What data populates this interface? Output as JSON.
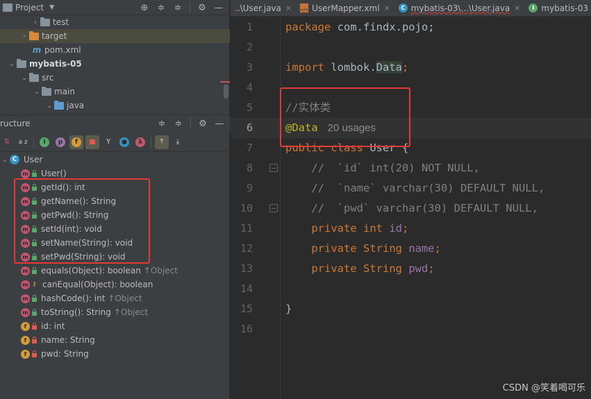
{
  "project_panel": {
    "title": "Project",
    "tree": [
      {
        "label": "test",
        "level": 3,
        "kind": "folder"
      },
      {
        "label": "target",
        "level": 2,
        "kind": "folder-orange"
      },
      {
        "label": "pom.xml",
        "level": 2,
        "kind": "maven"
      },
      {
        "label": "mybatis-05",
        "level": 1,
        "kind": "module"
      },
      {
        "label": "src",
        "level": 2,
        "kind": "folder"
      },
      {
        "label": "main",
        "level": 3,
        "kind": "folder"
      },
      {
        "label": "java",
        "level": 4,
        "kind": "folder-blue"
      }
    ]
  },
  "structure_panel": {
    "title": "ructure",
    "sort_label": "a z",
    "root": "User",
    "members": [
      {
        "name": "User()",
        "kind": "method",
        "vis": "pub"
      },
      {
        "name": "getId(): int",
        "kind": "method",
        "vis": "pub"
      },
      {
        "name": "getName(): String",
        "kind": "method",
        "vis": "pub"
      },
      {
        "name": "getPwd(): String",
        "kind": "method",
        "vis": "pub"
      },
      {
        "name": "setId(int): void",
        "kind": "method",
        "vis": "pub"
      },
      {
        "name": "setName(String): void",
        "kind": "method",
        "vis": "pub"
      },
      {
        "name": "setPwd(String): void",
        "kind": "method",
        "vis": "pub"
      },
      {
        "name": "equals(Object): boolean",
        "inherit": "↑Object",
        "kind": "method",
        "vis": "pub"
      },
      {
        "name": "canEqual(Object): boolean",
        "kind": "method",
        "vis": "prot"
      },
      {
        "name": "hashCode(): int",
        "inherit": "↑Object",
        "kind": "method",
        "vis": "pub"
      },
      {
        "name": "toString(): String",
        "inherit": "↑Object",
        "kind": "method",
        "vis": "pub"
      },
      {
        "name": "id: int",
        "kind": "field",
        "vis": "priv"
      },
      {
        "name": "name: String",
        "kind": "field",
        "vis": "priv"
      },
      {
        "name": "pwd: String",
        "kind": "field",
        "vis": "priv"
      }
    ]
  },
  "tabs": [
    {
      "label": "..\\User.java",
      "icon": "none"
    },
    {
      "label": "UserMapper.xml",
      "icon": "xml-icon"
    },
    {
      "label": "mybatis-03\\...\\User.java",
      "icon": "class-icon",
      "underline": true
    },
    {
      "label": "mybatis-03",
      "icon": "interface-icon"
    }
  ],
  "editor": {
    "line_numbers": [
      "1",
      "2",
      "3",
      "4",
      "5",
      "6",
      "7",
      "8",
      "9",
      "10",
      "11",
      "12",
      "13",
      "14",
      "15",
      "16"
    ],
    "current_line": "6",
    "line1": {
      "kw": "package",
      "rest": " com.findx.pojo;"
    },
    "line3": {
      "kw": "import",
      "pkg": " lombok.",
      "cls": "Data",
      "end": ";"
    },
    "line5": "//实体类",
    "line6": {
      "ann": "@Data",
      "hint": "20 usages"
    },
    "line7": {
      "kw1": "public",
      "kw2": " class",
      "rest": " User {"
    },
    "line8": "    //  `id` int(20) NOT NULL,",
    "line9": "    //  `name` varchar(30) DEFAULT NULL,",
    "line10": "    //  `pwd` varchar(30) DEFAULT NULL,",
    "line11": {
      "kw": "    private",
      "type": " int",
      "field": " id",
      "end": ";"
    },
    "line12": {
      "kw": "    private",
      "type": " String",
      "field": " name",
      "end": ";"
    },
    "line13": {
      "kw": "    private",
      "type": " String",
      "field": " pwd",
      "end": ";"
    },
    "line15": "}"
  },
  "watermark": "CSDN @笑着喝可乐"
}
